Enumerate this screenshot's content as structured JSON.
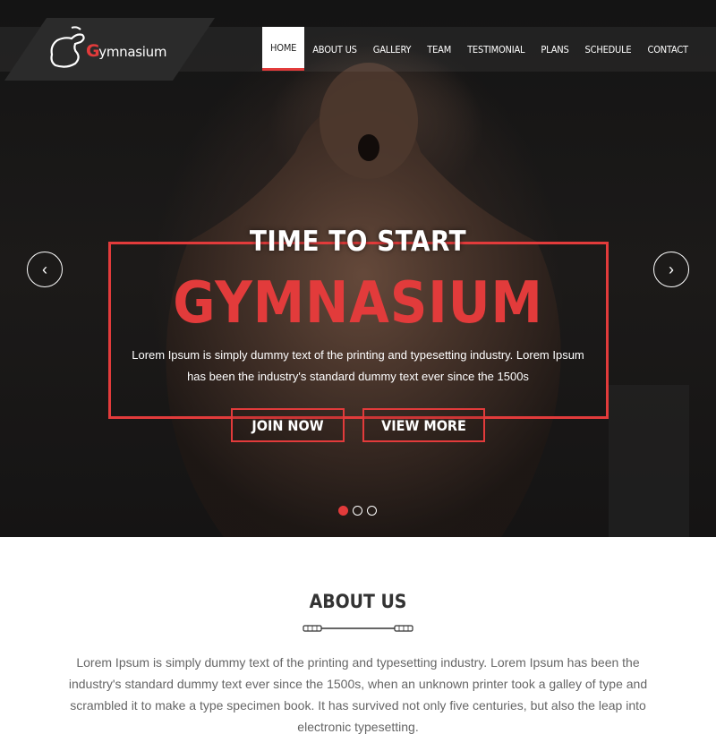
{
  "brand": {
    "logo_letter": "G",
    "logo_rest": "ymnasium",
    "accent": "#e23b3b"
  },
  "nav": {
    "items": [
      {
        "label": "HOME",
        "active": true
      },
      {
        "label": "ABOUT US"
      },
      {
        "label": "GALLERY"
      },
      {
        "label": "TEAM"
      },
      {
        "label": "TESTIMONIAL"
      },
      {
        "label": "PLANS"
      },
      {
        "label": "SCHEDULE"
      },
      {
        "label": "CONTACT"
      }
    ]
  },
  "hero": {
    "kicker": "TIME TO START",
    "title": "GYMNASIUM",
    "description": "Lorem Ipsum is simply dummy text of the printing and typesetting industry. Lorem Ipsum has been the industry's standard dummy text ever since the 1500s",
    "join_label": "JOIN NOW",
    "more_label": "VIEW MORE",
    "prev_icon": "‹",
    "next_icon": "›",
    "slide_count": 3,
    "active_slide": 1
  },
  "about": {
    "title": "ABOUT US",
    "text": "Lorem Ipsum is simply dummy text of the printing and typesetting industry. Lorem Ipsum has been the industry's standard dummy text ever since the 1500s, when an unknown printer took a galley of type and scrambled it to make a type specimen book. It has survived not only five centuries, but also the leap into electronic typesetting."
  }
}
